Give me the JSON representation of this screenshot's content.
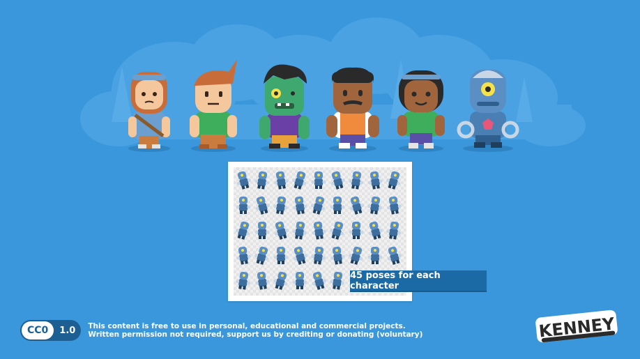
{
  "banner": {
    "poses_label": "45 poses for each character"
  },
  "license": {
    "badge_label": "CC0",
    "version": "1.0",
    "line1": "This content is free to use in personal, educational and commercial projects.",
    "line2": "Written permission not required, support us by crediting or donating (voluntary)"
  },
  "logo": {
    "text": "KENNEY"
  },
  "colors": {
    "background": "#3a97dc",
    "cloud": "#52a6e3",
    "banner": "#1b6aa6",
    "skin_light": "#f5c79c",
    "zombie_green": "#3fa86e",
    "robot_blue": "#4a7fb4"
  },
  "characters": [
    {
      "name": "adventurer-girl",
      "icon": "adventurer-girl-icon"
    },
    {
      "name": "adventurer-boy",
      "icon": "adventurer-boy-icon"
    },
    {
      "name": "zombie",
      "icon": "zombie-icon"
    },
    {
      "name": "soldier",
      "icon": "soldier-icon"
    },
    {
      "name": "female-player",
      "icon": "female-player-icon"
    },
    {
      "name": "robot",
      "icon": "robot-icon"
    }
  ],
  "sprite_sheet": {
    "rows": 5,
    "cols": 9,
    "pose_count": 45
  }
}
